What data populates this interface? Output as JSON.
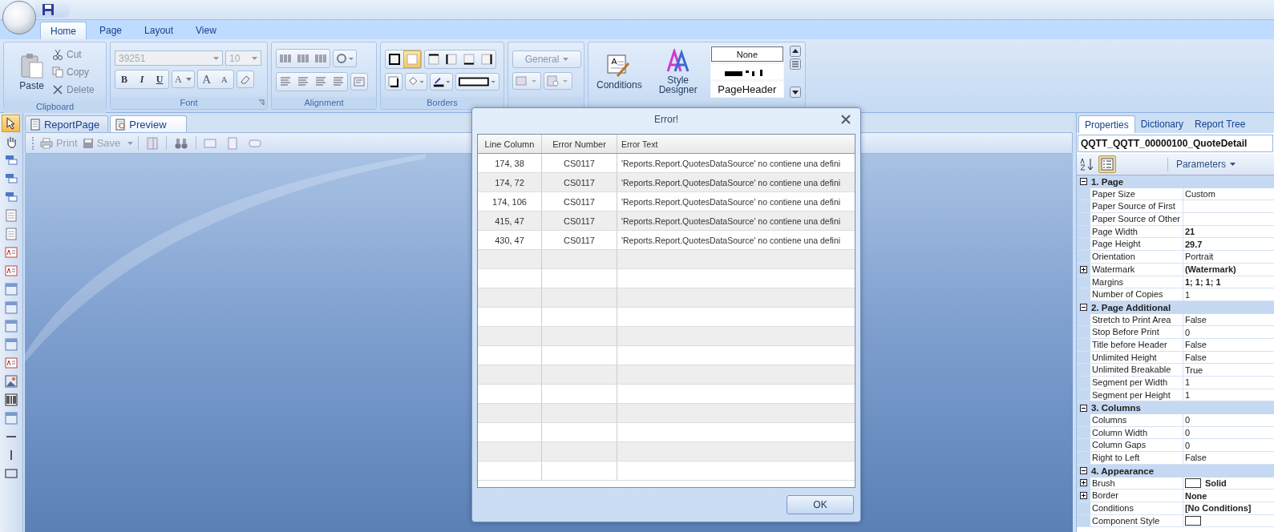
{
  "ribbon": {
    "tabs": [
      {
        "label": "Home",
        "selected": true
      },
      {
        "label": "Page",
        "selected": false
      },
      {
        "label": "Layout",
        "selected": false
      },
      {
        "label": "View",
        "selected": false
      }
    ],
    "clipboard": {
      "title": "Clipboard",
      "paste": "Paste",
      "cut": "Cut",
      "copy": "Copy",
      "delete": "Delete"
    },
    "font": {
      "title": "Font",
      "font_name": "39251",
      "font_size": "10",
      "disabled": true,
      "bold": "B",
      "italic": "I",
      "underline": "U",
      "font_color": "A",
      "grow": "A",
      "shrink": "A"
    },
    "alignment": {
      "title": "Alignment"
    },
    "borders": {
      "title": "Borders",
      "buttons": [
        {
          "kind": "none",
          "selected": false
        },
        {
          "kind": "all",
          "selected": true
        },
        {
          "kind": "top",
          "selected": false
        },
        {
          "kind": "left",
          "selected": false
        },
        {
          "kind": "bottom",
          "selected": false
        },
        {
          "kind": "right",
          "selected": false
        }
      ]
    },
    "text_format": {
      "format": "General",
      "disabled": true
    },
    "style": {
      "conditions": "Conditions",
      "style_designer": "Style Designer",
      "styles": [
        {
          "kind": "text",
          "label": "None"
        },
        {
          "kind": "sample"
        },
        {
          "kind": "text",
          "label": "PageHeader"
        }
      ]
    }
  },
  "toolbox": [
    {
      "kind": "pointer",
      "selected": true
    },
    {
      "kind": "hand",
      "selected": false
    },
    {
      "kind": "band",
      "selected": false
    },
    {
      "kind": "band",
      "selected": false
    },
    {
      "kind": "band",
      "selected": false
    },
    {
      "kind": "page",
      "selected": false
    },
    {
      "kind": "page",
      "selected": false
    },
    {
      "kind": "text",
      "selected": false
    },
    {
      "kind": "text",
      "selected": false
    },
    {
      "kind": "panel",
      "selected": false
    },
    {
      "kind": "panel",
      "selected": false
    },
    {
      "kind": "panel",
      "selected": false
    },
    {
      "kind": "panel",
      "selected": false
    },
    {
      "kind": "text",
      "selected": false
    },
    {
      "kind": "image",
      "selected": false
    },
    {
      "kind": "barcode",
      "selected": false
    },
    {
      "kind": "panel",
      "selected": false
    },
    {
      "kind": "hline",
      "selected": false
    },
    {
      "kind": "vline",
      "selected": false
    },
    {
      "kind": "rect",
      "selected": false
    }
  ],
  "document": {
    "tabs": [
      {
        "label": "ReportPage",
        "selected": false
      },
      {
        "label": "Preview",
        "selected": true
      }
    ],
    "toolbar": {
      "print": "Print",
      "save": "Save",
      "disabled": true
    }
  },
  "properties_panel": {
    "tabs": [
      {
        "label": "Properties",
        "selected": true
      },
      {
        "label": "Dictionary",
        "selected": false
      },
      {
        "label": "Report Tree",
        "selected": false
      }
    ],
    "component": "QQTT_QQTT_00000100_QuoteDetail",
    "parameters": "Parameters",
    "categorized": true,
    "categories": [
      {
        "title": "1. Page",
        "expanded": true,
        "items": [
          {
            "name": "Paper Size",
            "value": "Custom",
            "bold": false
          },
          {
            "name": "Paper Source of First"
          },
          {
            "name": "Paper Source of Other"
          },
          {
            "name": "Page Width",
            "value": "21",
            "bold": true
          },
          {
            "name": "Page Height",
            "value": "29.7",
            "bold": true
          },
          {
            "name": "Orientation",
            "value": "Portrait",
            "bold": false
          },
          {
            "name": "Watermark",
            "value": "(Watermark)",
            "bold": true,
            "expandable": true
          },
          {
            "name": "Margins",
            "value": "1; 1; 1; 1",
            "bold": true
          },
          {
            "name": "Number of Copies",
            "value": "1",
            "bold": false
          }
        ]
      },
      {
        "title": "2. Page Additional",
        "expanded": true,
        "items": [
          {
            "name": "Stretch to Print Area",
            "value": "False",
            "bold": false
          },
          {
            "name": "Stop Before Print",
            "value": "0",
            "bold": false
          },
          {
            "name": "Title before Header",
            "value": "False",
            "bold": false
          },
          {
            "name": "Unlimited Height",
            "value": "False",
            "bold": false
          },
          {
            "name": "Unlimited Breakable",
            "value": "True",
            "bold": false
          },
          {
            "name": "Segment per Width",
            "value": "1",
            "bold": false
          },
          {
            "name": "Segment per Height",
            "value": "1",
            "bold": false
          }
        ]
      },
      {
        "title": "3. Columns",
        "expanded": true,
        "items": [
          {
            "name": "Columns",
            "value": "0",
            "bold": false
          },
          {
            "name": "Column Width",
            "value": "0",
            "bold": false
          },
          {
            "name": "Column Gaps",
            "value": "0",
            "bold": false
          },
          {
            "name": "Right to Left",
            "value": "False",
            "bold": false
          }
        ]
      },
      {
        "title": "4. Appearance",
        "expanded": true,
        "items": [
          {
            "name": "Brush",
            "value": "Solid",
            "bold": true,
            "expandable": true,
            "swatch": true
          },
          {
            "name": "Border",
            "value": "None",
            "bold": true,
            "expandable": true
          },
          {
            "name": "Conditions",
            "value": "[No Conditions]",
            "bold": true
          },
          {
            "name": "Component Style",
            "swatch": true
          }
        ]
      }
    ]
  },
  "dialog": {
    "title": "Error!",
    "columns": [
      "Line Column",
      "Error Number",
      "Error Text"
    ],
    "rows": [
      [
        "174, 38",
        "CS0117",
        "'Reports.Report.QuotesDataSource' no contiene una defini"
      ],
      [
        "174, 72",
        "CS0117",
        "'Reports.Report.QuotesDataSource' no contiene una defini"
      ],
      [
        "174, 106",
        "CS0117",
        "'Reports.Report.QuotesDataSource' no contiene una defini"
      ],
      [
        "415, 47",
        "CS0117",
        "'Reports.Report.QuotesDataSource' no contiene una defini"
      ],
      [
        "430, 47",
        "CS0117",
        "'Reports.Report.QuotesDataSource' no contiene una defini"
      ]
    ],
    "ok": "OK"
  }
}
